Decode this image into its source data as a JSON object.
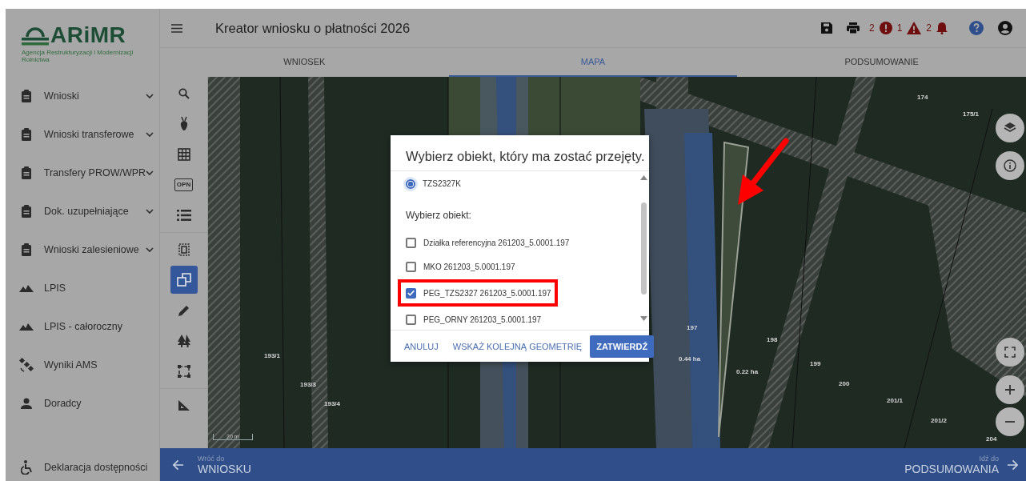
{
  "logo": {
    "name": "ARiMR",
    "subtitle": "Agencja Restrukturyzacji i Modernizacji Rolnictwa"
  },
  "sidebar": {
    "items": [
      {
        "label": "Wnioski",
        "kind": "group"
      },
      {
        "label": "Wnioski transferowe",
        "kind": "group"
      },
      {
        "label": "Transfery PROW/WPR",
        "kind": "group"
      },
      {
        "label": "Dok. uzupełniające",
        "kind": "group"
      },
      {
        "label": "Wnioski zalesieniowe",
        "kind": "group"
      },
      {
        "label": "LPIS",
        "kind": "map"
      },
      {
        "label": "LPIS - całoroczny",
        "kind": "map"
      },
      {
        "label": "Wyniki AMS",
        "kind": "ams"
      },
      {
        "label": "Doradcy",
        "kind": "advisors"
      }
    ],
    "footer": {
      "label": "Deklaracja dostępności"
    }
  },
  "header": {
    "title": "Kreator wniosku o płatności 2026",
    "counters": [
      {
        "kind": "error",
        "count": "2"
      },
      {
        "kind": "warning",
        "count": "1"
      },
      {
        "kind": "notification",
        "count": "2"
      }
    ]
  },
  "tabs": [
    {
      "label": "WNIOSEK",
      "selected": false
    },
    {
      "label": "MAPA",
      "selected": true
    },
    {
      "label": "PODSUMOWANIE",
      "selected": false
    }
  ],
  "toolbar": {
    "groups": [
      [
        {
          "kind": "search",
          "selected": false
        },
        {
          "kind": "plant",
          "selected": false
        },
        {
          "kind": "grid",
          "selected": false
        },
        {
          "kind": "badge",
          "label": "OPN",
          "selected": false
        },
        {
          "kind": "list",
          "selected": false
        }
      ],
      [
        {
          "kind": "select",
          "selected": false
        },
        {
          "kind": "copy",
          "selected": true
        },
        {
          "kind": "edit",
          "selected": false
        },
        {
          "kind": "trees",
          "selected": false
        },
        {
          "kind": "rectangle",
          "selected": false
        }
      ],
      [
        {
          "kind": "measure",
          "selected": false
        }
      ]
    ]
  },
  "map": {
    "labels": [
      "174",
      "175/1",
      "193/1",
      "193/3",
      "193/4",
      "197",
      "0.44 ha",
      "0.22 ha",
      "198",
      "199",
      "200",
      "201/1",
      "201/2",
      "204"
    ],
    "scale": "20 m"
  },
  "dialog": {
    "title": "Wybierz obiekt, który ma zostać przejęty.",
    "options": [
      {
        "label": "TZS2327K",
        "selected": true
      }
    ],
    "section_label": "Wybierz obiekt:",
    "objects": [
      {
        "label": "Działka referencyjna 261203_5.0001.197",
        "checked": false,
        "highlighted": false
      },
      {
        "label": "MKO 261203_5.0001.197",
        "checked": false,
        "highlighted": false
      },
      {
        "label": "PEG_TZS2327 261203_5.0001.197",
        "checked": true,
        "highlighted": true
      },
      {
        "label": "PEG_ORNY 261203_5.0001.197",
        "checked": false,
        "highlighted": false
      }
    ],
    "buttons": [
      {
        "label": "ANULUJ",
        "kind": "text"
      },
      {
        "label": "WSKAŻ KOLEJNĄ GEOMETRIĘ",
        "kind": "text"
      },
      {
        "label": "ZATWIERDŹ",
        "kind": "primary"
      }
    ]
  },
  "bottom_nav": {
    "back": {
      "caption": "Wróć do",
      "label": "WNIOSKU"
    },
    "next": {
      "caption": "Idź do",
      "label": "PODSUMOWANIA"
    }
  }
}
